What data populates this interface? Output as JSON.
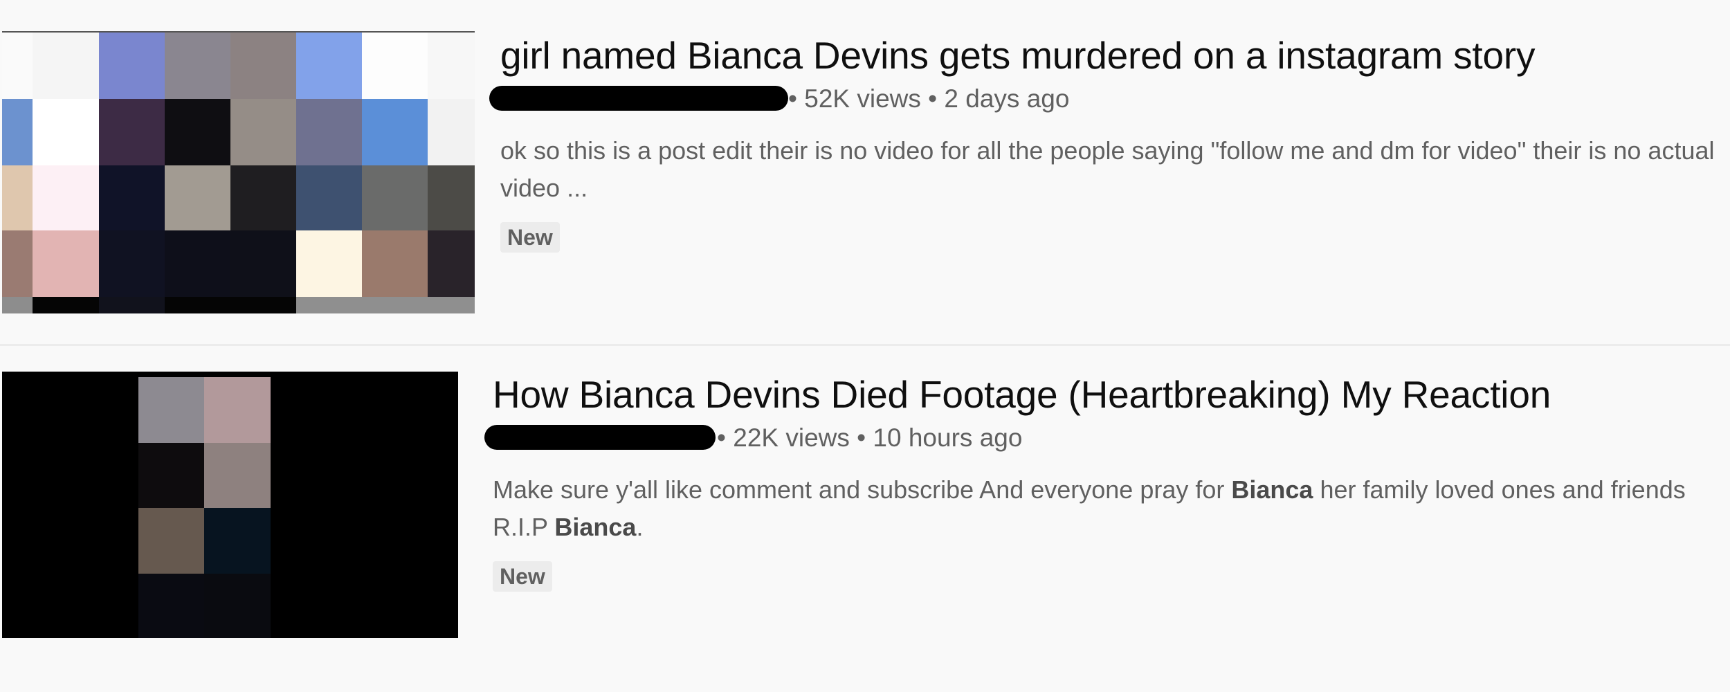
{
  "results": [
    {
      "title": "girl named Bianca Devins gets murdered on a instagram story",
      "views": "52K views",
      "age": "2 days ago",
      "description": "ok so this is a post edit their is no video for all the people saying \"follow me and dm for video\" their is no actual video ...",
      "badge": "New"
    },
    {
      "title": "How Bianca Devins Died Footage (Heartbreaking) My Reaction",
      "views": "22K views",
      "age": "10 hours ago",
      "description_parts": [
        "Make sure y'all like comment and subscribe And everyone pray for ",
        "Bianca",
        " her family loved ones and friends R.I.P ",
        "Bianca",
        "."
      ],
      "badge": "New"
    }
  ],
  "separator": "•",
  "colors": {
    "background": "#f9f9f9",
    "title": "#0f0f0f",
    "meta": "#606060",
    "badge_bg": "#ececec",
    "redaction": "#000000"
  }
}
